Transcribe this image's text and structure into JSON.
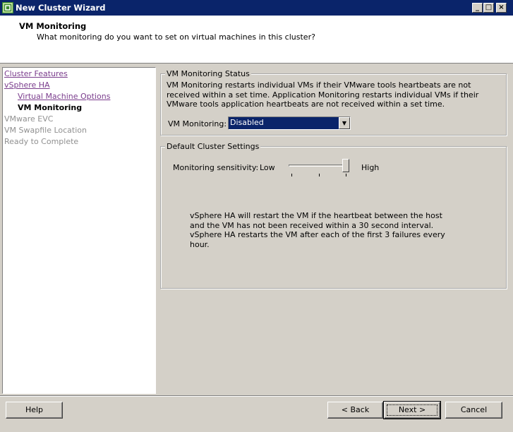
{
  "window": {
    "title": "New Cluster Wizard",
    "icon": "vsphere-cluster-icon",
    "controls": [
      "minimize-icon",
      "maximize-icon",
      "close-icon"
    ]
  },
  "header": {
    "title": "VM Monitoring",
    "subtitle": "What monitoring do you want to set on virtual machines in this cluster?"
  },
  "nav": {
    "items": [
      {
        "label": "Cluster Features",
        "state": "link"
      },
      {
        "label": "vSphere HA",
        "state": "link"
      },
      {
        "label": "Virtual Machine Options",
        "state": "link"
      },
      {
        "label": "VM Monitoring",
        "state": "current"
      },
      {
        "label": "VMware EVC",
        "state": "disabled"
      },
      {
        "label": "VM Swapfile Location",
        "state": "disabled"
      },
      {
        "label": "Ready to Complete",
        "state": "disabled"
      }
    ]
  },
  "status_group": {
    "legend": "VM Monitoring Status",
    "description": "VM Monitoring restarts individual VMs if their VMware tools heartbeats are not received within a set time.  Application Monitoring restarts individual VMs if their VMware tools application heartbeats are not received within a set time.",
    "field_label": "VM Monitoring:",
    "selected_value": "Disabled"
  },
  "cluster_group": {
    "legend": "Default Cluster Settings",
    "sensitivity_label": "Monitoring sensitivity:",
    "low_label": "Low",
    "high_label": "High",
    "sensitivity_level": "High",
    "description": "vSphere HA will restart the VM if the heartbeat between the host and the VM has not been received within a 30 second interval. vSphere HA restarts the VM after each of the first 3 failures every hour."
  },
  "buttons": {
    "help": "Help",
    "back": "< Back",
    "next": "Next >",
    "cancel": "Cancel"
  },
  "colors": {
    "titlebar": "#0a246a",
    "link": "#7a3c8c",
    "disabled": "#909090",
    "dialog": "#d4d0c8"
  }
}
